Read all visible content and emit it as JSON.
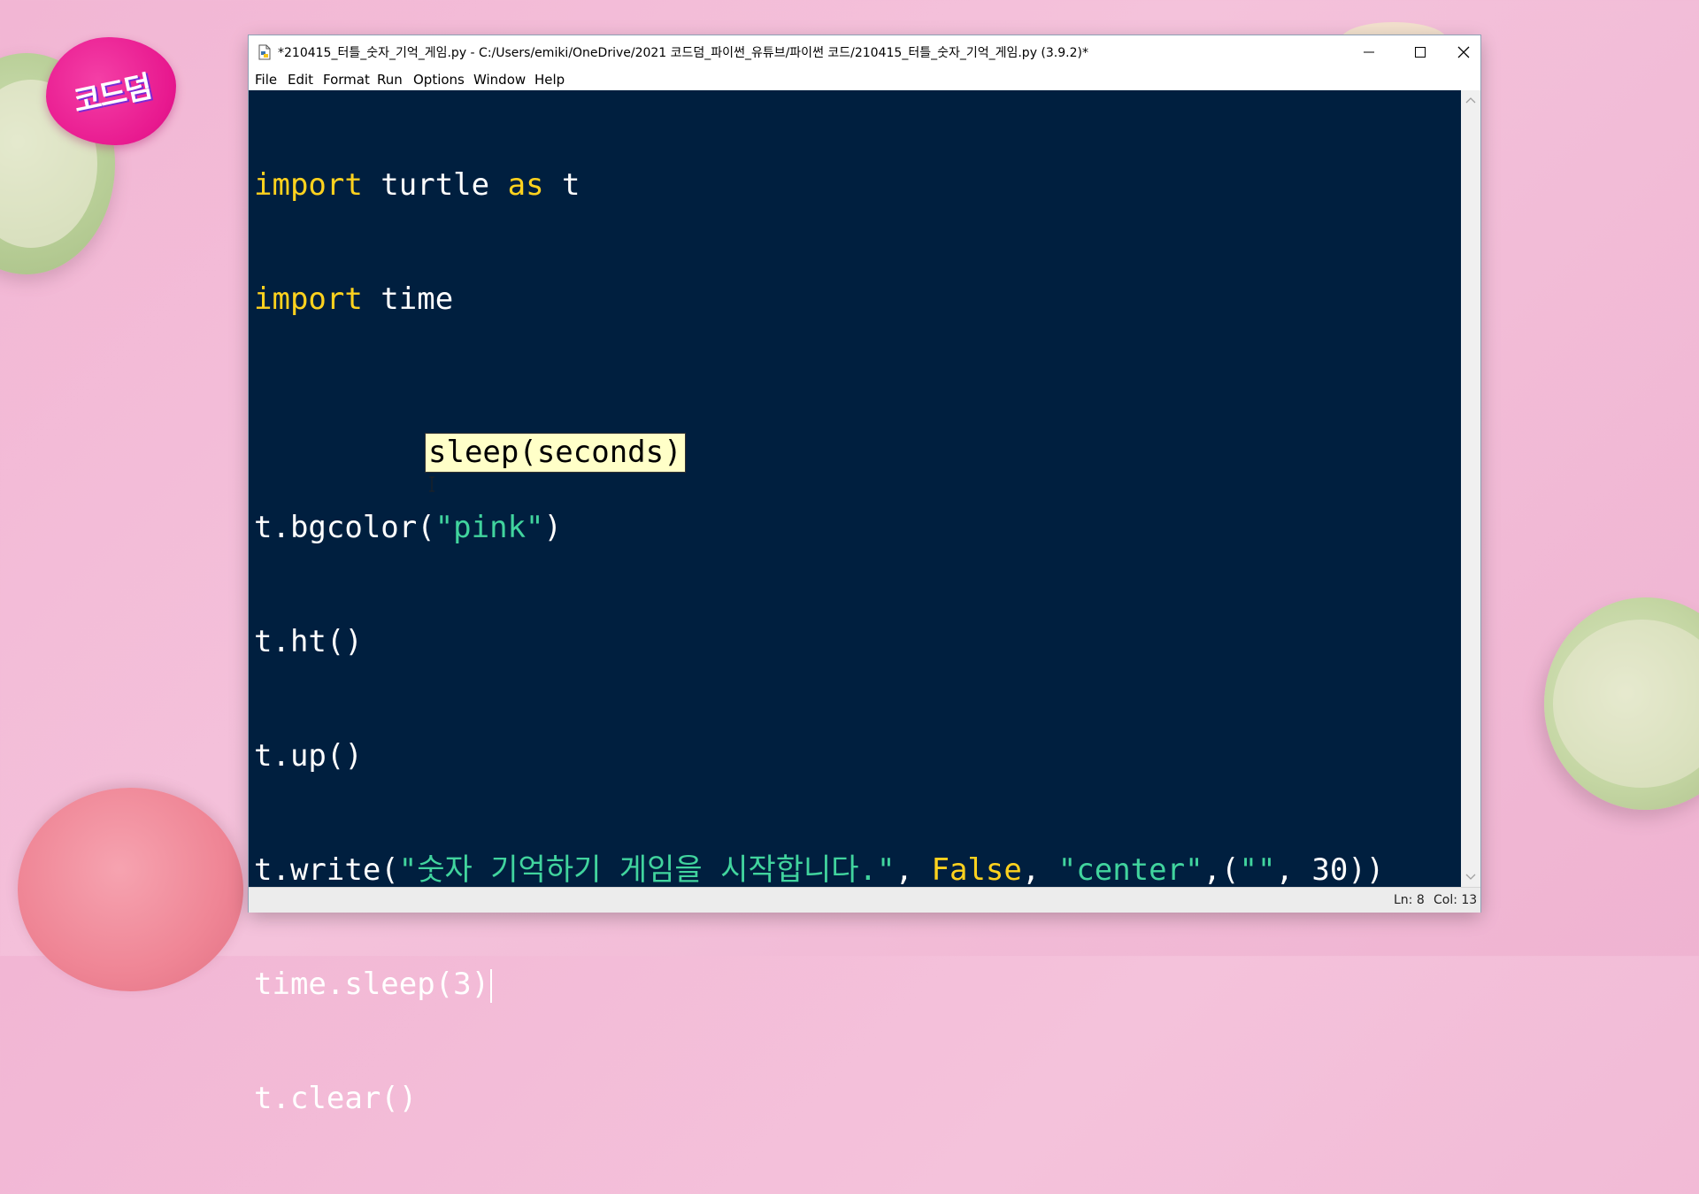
{
  "window": {
    "title": "*210415_터틀_숫자_기억_게임.py - C:/Users/emiki/OneDrive/2021 코드덤_파이썬_유튜브/파이썬 코드/210415_터틀_숫자_기억_게임.py (3.9.2)*"
  },
  "menu": {
    "items": [
      "File",
      "Edit",
      "Format",
      "Run",
      "Options",
      "Window",
      "Help"
    ]
  },
  "code": {
    "line1": {
      "kw1": "import",
      "mid": " turtle ",
      "kw2": "as",
      "end": " t"
    },
    "line2": {
      "kw": "import",
      "end": " time"
    },
    "line4": {
      "pre": "t.bgcolor(",
      "str": "\"pink\"",
      "post": ")"
    },
    "line5": "t.ht()",
    "line6": "t.up()",
    "line7": {
      "pre": "t.write(",
      "str1": "\"숫자 기억하기 게임을 시작합니다.\"",
      "sep1": ", ",
      "kw": "False",
      "sep2": ", ",
      "str2": "\"center\"",
      "sep3": ",(",
      "str3": "\"\"",
      "post": ", 30))"
    },
    "line8": "time.sleep(3)",
    "line9": "t.clear()"
  },
  "tooltip": {
    "text": "sleep(seconds)"
  },
  "status": {
    "line": "Ln: 8",
    "col": "Col: 13"
  },
  "colors": {
    "editor_bg": "#001f3f",
    "keyword": "#ffd21e",
    "string": "#41d49e",
    "tooltip_bg": "#ffffc8"
  }
}
